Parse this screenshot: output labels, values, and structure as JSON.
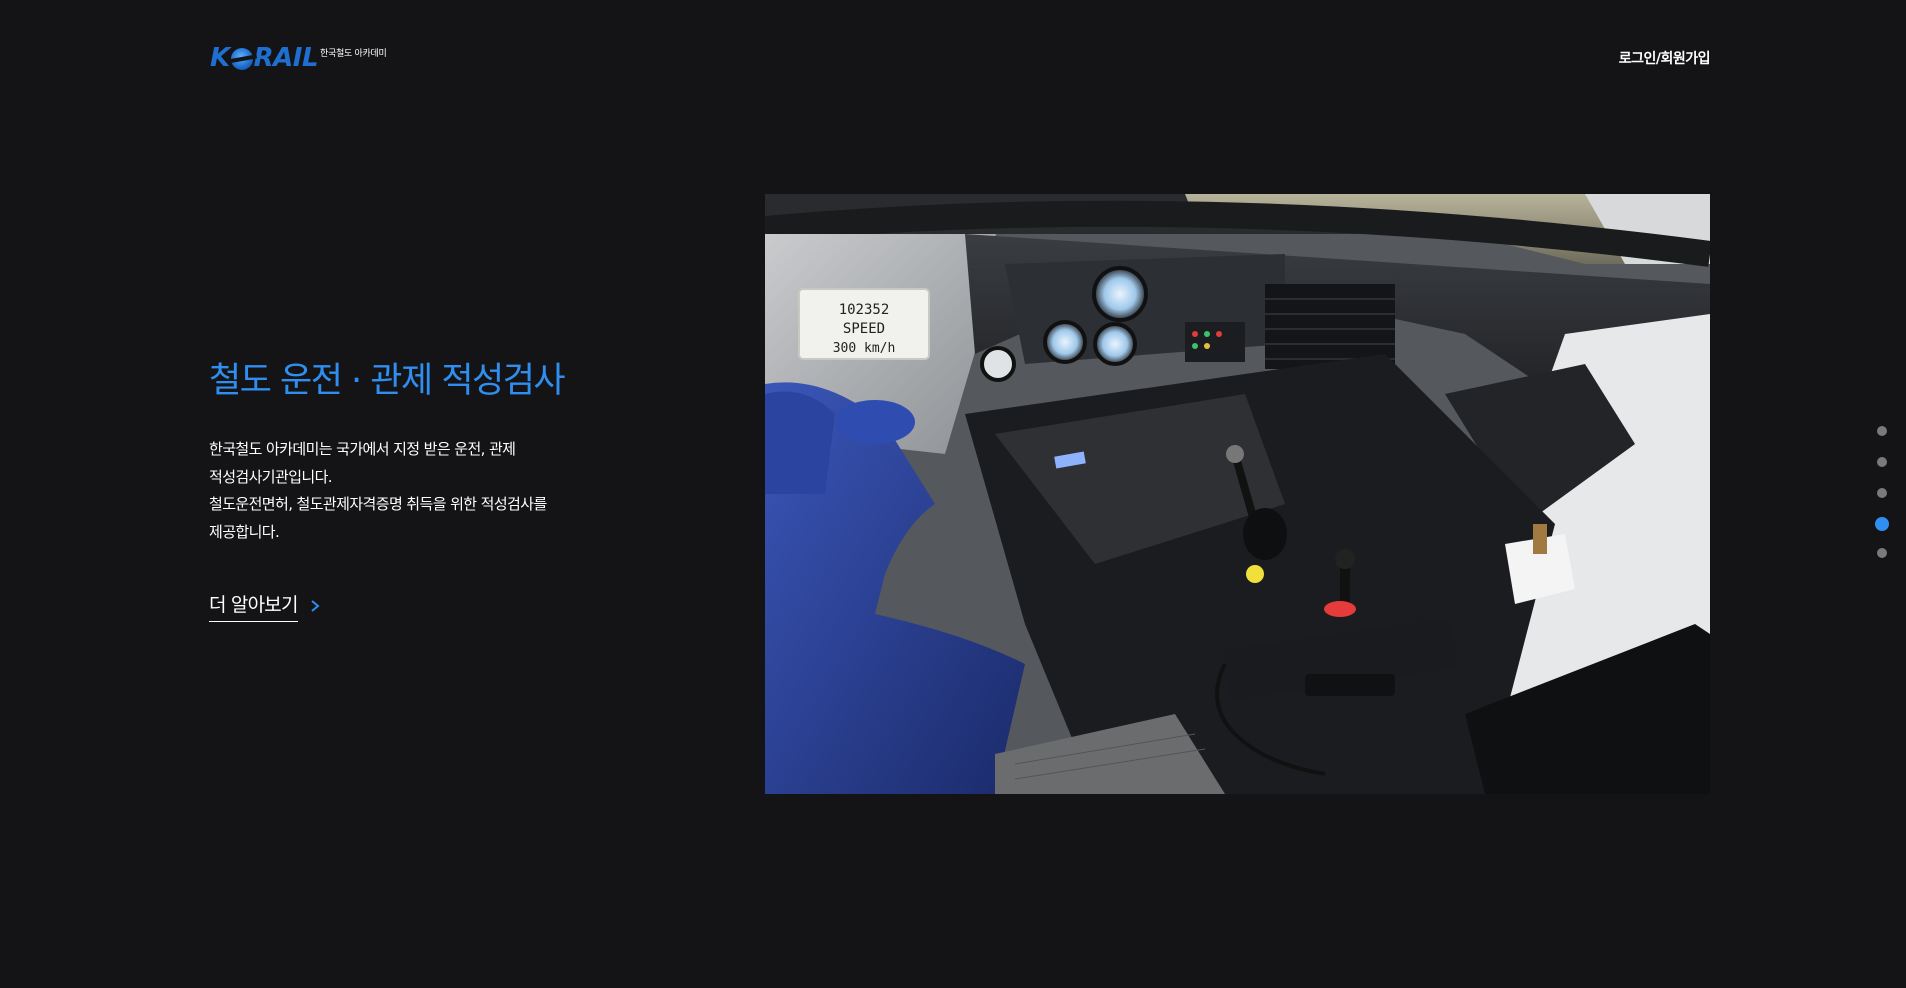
{
  "header": {
    "logo_text": "KORAIL",
    "logo_subtitle": "한국철도 아카데미",
    "login_label": "로그인/회원가입"
  },
  "hero": {
    "title": "철도 운전 · 관제 적성검사",
    "description_lines": [
      "한국철도 아카데미는 국가에서 지정 받은 운전, 관제",
      "적성검사기관입니다.",
      "철도운전면허, 철도관제자격증명 취득을 위한 적성검사를",
      "제공합니다."
    ],
    "more_label": "더 알아보기"
  },
  "photo": {
    "plate_lines": [
      "102352",
      "SPEED",
      "300  km/h"
    ]
  },
  "pagination": {
    "count": 5,
    "active_index": 3
  },
  "colors": {
    "background": "#141416",
    "accent": "#2f8ef0",
    "logo_blue": "#1f6fd1",
    "dot_inactive": "#7a7a7e"
  }
}
